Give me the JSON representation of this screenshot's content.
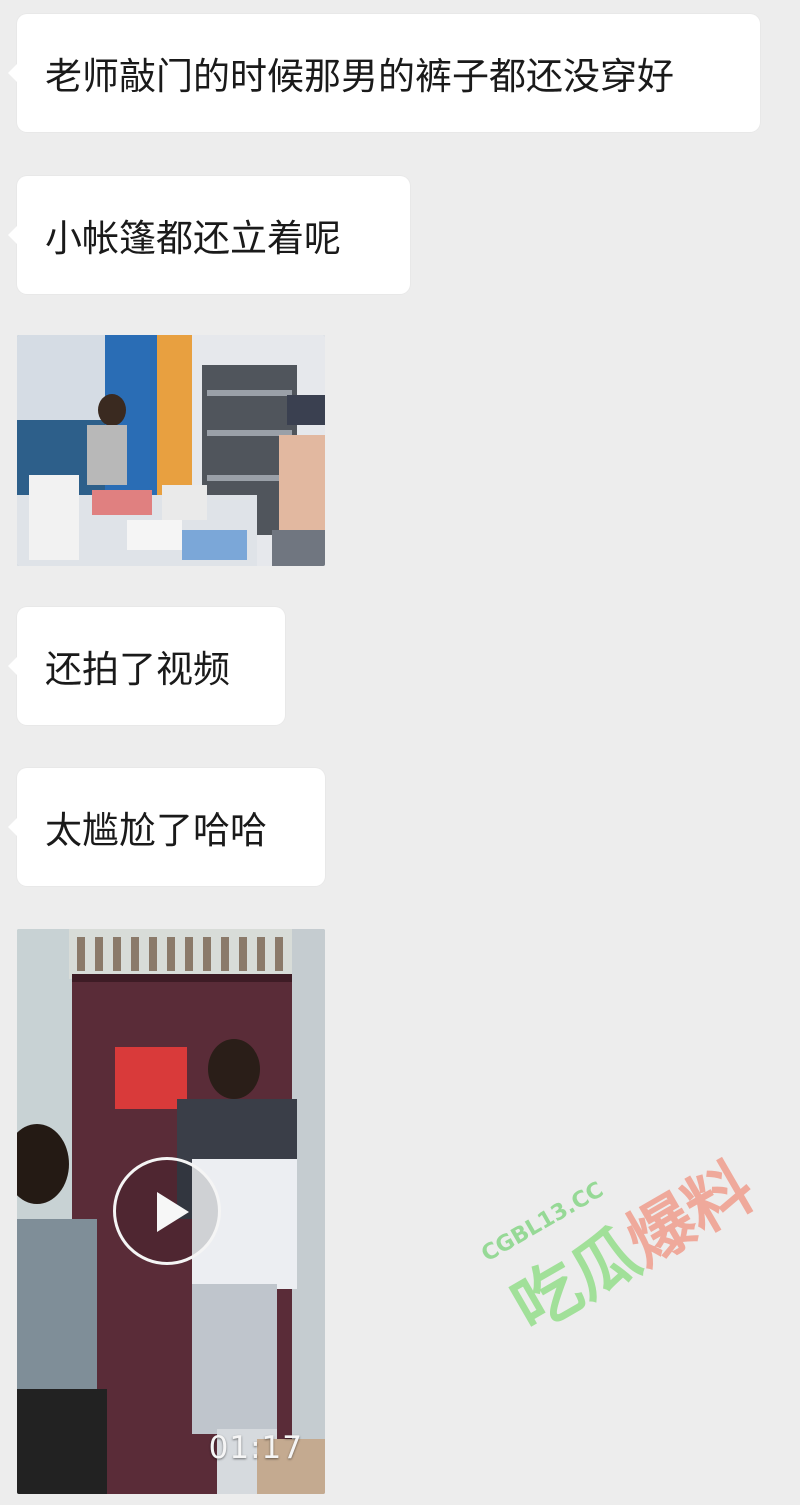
{
  "messages": [
    {
      "type": "text",
      "text": "老师敲门的时候那男的裤子都还没穿好"
    },
    {
      "type": "text",
      "text": "小帐篷都还立着呢"
    },
    {
      "type": "image",
      "description_icon": "photo-icon"
    },
    {
      "type": "text",
      "text": "还拍了视频"
    },
    {
      "type": "text",
      "text": "太尴尬了哈哈"
    },
    {
      "type": "video",
      "duration": "01:17",
      "icon": "play-icon"
    }
  ],
  "watermark": {
    "site": "CGBL13.CC",
    "brand_part1": "吃瓜",
    "brand_part2": "爆料",
    "colors": {
      "green": "#8cdc82",
      "red": "#f08c78"
    }
  },
  "colors": {
    "background": "#ededed",
    "bubble": "#ffffff",
    "text": "#1a1a1a"
  }
}
